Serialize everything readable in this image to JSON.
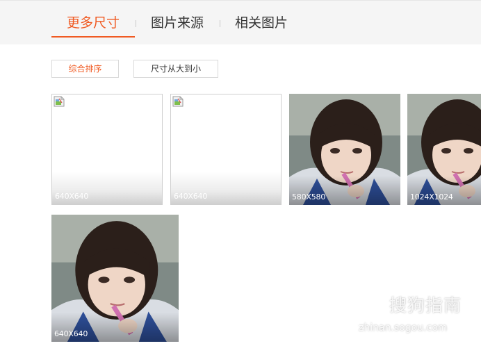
{
  "tabs": [
    {
      "label": "更多尺寸",
      "active": true
    },
    {
      "label": "图片来源",
      "active": false
    },
    {
      "label": "相关图片",
      "active": false
    }
  ],
  "sort": {
    "composite_label": "综合排序",
    "size_desc_label": "尺寸从大到小"
  },
  "images": [
    {
      "size": "640X640",
      "loaded": false
    },
    {
      "size": "640X640",
      "loaded": false
    },
    {
      "size": "580X580",
      "loaded": true
    },
    {
      "size": "1024X1024",
      "loaded": true
    },
    {
      "size": "640X640",
      "loaded": true
    }
  ],
  "watermark": {
    "title": "搜狗指南",
    "url": "zhinan.sogou.com",
    "icon": "sogou-logo-icon"
  },
  "colors": {
    "accent": "#f05a22",
    "tabbar_bg": "#f5f5f5"
  }
}
